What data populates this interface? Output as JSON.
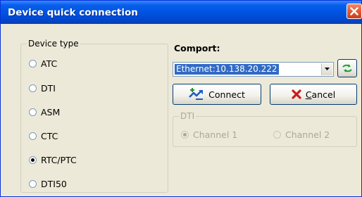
{
  "window": {
    "title": "Device quick connection"
  },
  "device_type": {
    "label": "Device type",
    "options": [
      {
        "label": "ATC",
        "checked": false
      },
      {
        "label": "DTI",
        "checked": false
      },
      {
        "label": "ASM",
        "checked": false
      },
      {
        "label": "CTC",
        "checked": false
      },
      {
        "label": "RTC/PTC",
        "checked": true
      },
      {
        "label": "DTI50",
        "checked": false
      }
    ]
  },
  "comport": {
    "label": "Comport:",
    "value": "Ethernet:10.138.20.222"
  },
  "buttons": {
    "connect": "Connect",
    "cancel_first": "C",
    "cancel_rest": "ancel"
  },
  "dti": {
    "label": "DTI",
    "channels": [
      {
        "label": "Channel 1",
        "checked": true,
        "enabled": false
      },
      {
        "label": "Channel 2",
        "checked": false,
        "enabled": false
      }
    ]
  },
  "icons": {
    "close": "close-icon",
    "refresh": "refresh-icon",
    "connect": "connect-icon",
    "cancel": "cancel-x-icon",
    "dropdown": "chevron-down-icon"
  },
  "colors": {
    "titlebar": "#0055E5",
    "dialog_bg": "#ECE9D8",
    "selection": "#316AC5",
    "close": "#E25A36",
    "cancel_x": "#CC1B1B",
    "connect_icon": "#1E5BC6"
  }
}
